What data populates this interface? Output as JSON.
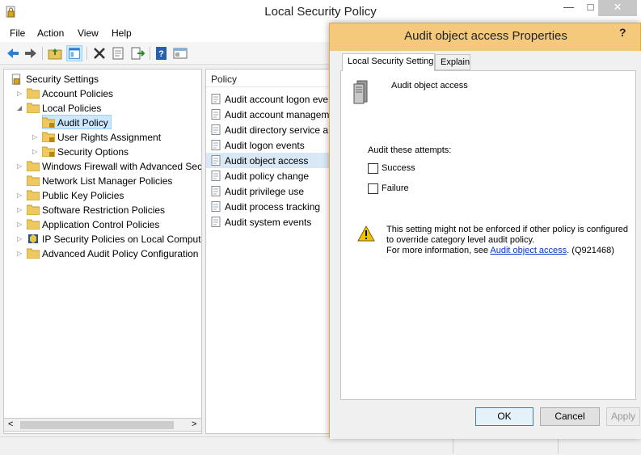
{
  "window": {
    "title": "Local Security Policy",
    "minimize": "—",
    "maximize": "□",
    "close": "✕"
  },
  "menu": [
    "File",
    "Action",
    "View",
    "Help"
  ],
  "toolbar": [
    "back-icon",
    "forward-icon",
    "up-folder-icon",
    "show-hide-tree-icon",
    "delete-icon",
    "properties-icon",
    "export-list-icon",
    "help-icon",
    "mmc-icon"
  ],
  "tree": {
    "items": [
      {
        "label": "Security Settings"
      },
      {
        "label": "Account Policies"
      },
      {
        "label": "Local Policies"
      },
      {
        "label": "Audit Policy"
      },
      {
        "label": "User Rights Assignment"
      },
      {
        "label": "Security Options"
      },
      {
        "label": "Windows Firewall with Advanced Secu"
      },
      {
        "label": "Network List Manager Policies"
      },
      {
        "label": "Public Key Policies"
      },
      {
        "label": "Software Restriction Policies"
      },
      {
        "label": "Application Control Policies"
      },
      {
        "label": "IP Security Policies on Local Compute"
      },
      {
        "label": "Advanced Audit Policy Configuration"
      }
    ],
    "scroll_left": "<",
    "scroll_right": ">"
  },
  "list": {
    "header": "Policy",
    "items": [
      {
        "label": "Audit account logon eve"
      },
      {
        "label": "Audit account managem"
      },
      {
        "label": "Audit directory service a"
      },
      {
        "label": "Audit logon events"
      },
      {
        "label": "Audit object access"
      },
      {
        "label": "Audit policy change"
      },
      {
        "label": "Audit privilege use"
      },
      {
        "label": "Audit process tracking"
      },
      {
        "label": "Audit system events"
      }
    ]
  },
  "dialog": {
    "title": "Audit object access Properties",
    "help": "?",
    "tabs": [
      "Local Security Setting",
      "Explain"
    ],
    "policy_name": "Audit object access",
    "attempts_label": "Audit these attempts:",
    "success_label": "Success",
    "failure_label": "Failure",
    "warning_line1": "This setting might not be enforced if other policy is configured to override category level audit policy.",
    "warning_more": "For more information, see ",
    "warning_link": "Audit object access",
    "warning_suffix": ". (Q921468)",
    "ok": "OK",
    "cancel": "Cancel",
    "apply": "Apply"
  },
  "colors": {
    "dialog_frame": "#f5c97b",
    "selection": "#cce8ff",
    "link": "#0033cc"
  }
}
